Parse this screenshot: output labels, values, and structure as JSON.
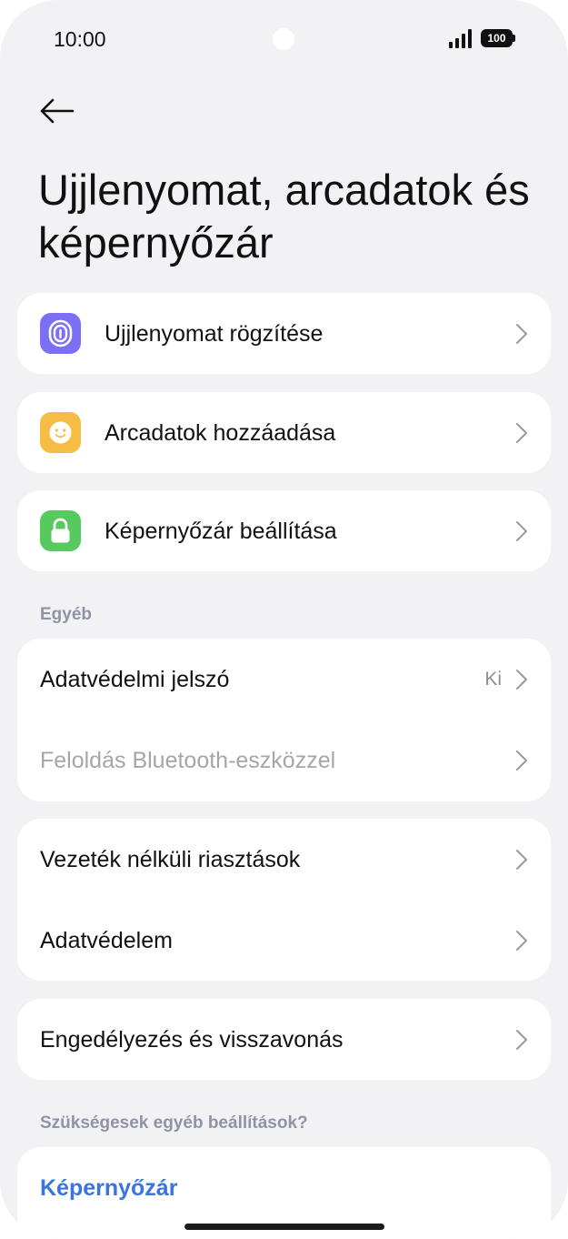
{
  "status_bar": {
    "time": "10:00",
    "battery": "100"
  },
  "title": "Ujjlenyomat, arcadatok és képernyőzár",
  "security_items": [
    {
      "label": "Ujjlenyomat rögzítése",
      "icon": "fingerprint-icon",
      "color": "#7a6ff5"
    },
    {
      "label": "Arcadatok hozzáadása",
      "icon": "face-icon",
      "color": "#f6bd45"
    },
    {
      "label": "Képernyőzár beállítása",
      "icon": "lock-icon",
      "color": "#56c95f"
    }
  ],
  "section_other": "Egyéb",
  "other_group_1": [
    {
      "label": "Adatvédelmi jelszó",
      "value": "Ki"
    },
    {
      "label": "Feloldás Bluetooth-eszközzel"
    }
  ],
  "other_group_2": [
    {
      "label": "Vezeték nélküli riasztások"
    },
    {
      "label": "Adatvédelem"
    }
  ],
  "other_group_3": [
    {
      "label": "Engedélyezés és visszavonás"
    }
  ],
  "section_more": "Szükségesek egyéb beállítások?",
  "more_link": "Képernyőzár",
  "colors": {
    "accent_link": "#3a74e0",
    "background": "#f2f2f4",
    "section_header": "#8f93a6"
  }
}
